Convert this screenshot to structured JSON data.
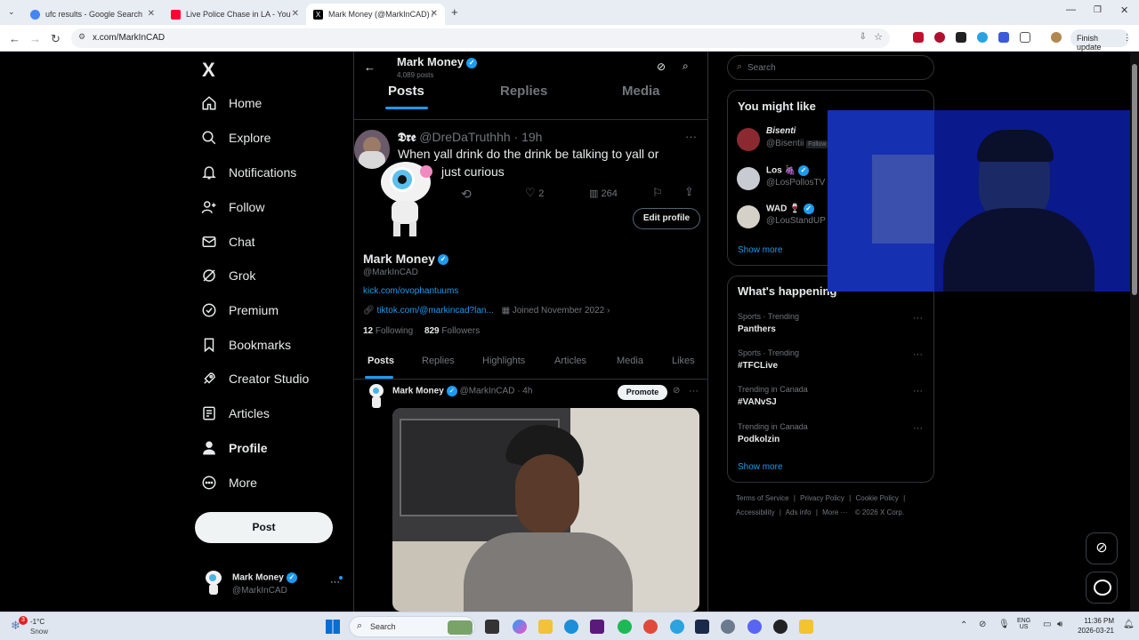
{
  "browser": {
    "tabs": [
      {
        "title": "ufc results - Google Search",
        "active": false
      },
      {
        "title": "Live Police Chase in LA - YouTu",
        "active": false
      },
      {
        "title": "Mark Money (@MarkInCAD) / X",
        "active": true
      }
    ],
    "new_tab": "+",
    "url": "x.com/MarkInCAD",
    "finish_update": "Finish update"
  },
  "sidebar": {
    "logo": "X",
    "items": [
      {
        "label": "Home",
        "icon": "home-icon"
      },
      {
        "label": "Explore",
        "icon": "search-icon"
      },
      {
        "label": "Notifications",
        "icon": "bell-icon"
      },
      {
        "label": "Follow",
        "icon": "person-add-icon"
      },
      {
        "label": "Chat",
        "icon": "mail-icon"
      },
      {
        "label": "Grok",
        "icon": "grok-icon"
      },
      {
        "label": "Premium",
        "icon": "premium-icon"
      },
      {
        "label": "Bookmarks",
        "icon": "bookmark-icon"
      },
      {
        "label": "Creator Studio",
        "icon": "rocket-icon"
      },
      {
        "label": "Articles",
        "icon": "article-icon"
      },
      {
        "label": "Profile",
        "icon": "person-icon"
      },
      {
        "label": "More",
        "icon": "more-circle-icon"
      }
    ],
    "post_label": "Post",
    "account": {
      "name": "Mark Money",
      "handle": "@MarkInCAD",
      "more": "···"
    }
  },
  "header": {
    "name": "Mark Money",
    "posts_count": "4,089 posts",
    "tabs": [
      "Posts",
      "Replies",
      "Media"
    ]
  },
  "floating_tweet": {
    "author": "𝕯𝖗𝖊",
    "handle": "@DreDaTruthhh",
    "time": "· 19h",
    "text_line1": "When yall drink do the drink be talking to yall or",
    "text_line2": "just curious",
    "likes": "2",
    "views": "264",
    "more": "···"
  },
  "profile": {
    "edit_label": "Edit profile",
    "name": "Mark Money",
    "handle": "@MarkInCAD",
    "bio_link": "kick.com/ovophantuums",
    "website": "tiktok.com/@markincad?lan...",
    "joined": "Joined November 2022",
    "following_count": "12",
    "following_label": "Following",
    "followers_count": "829",
    "followers_label": "Followers",
    "tabs": [
      "Posts",
      "Replies",
      "Highlights",
      "Articles",
      "Media",
      "Likes"
    ]
  },
  "post": {
    "author": "Mark Money",
    "handle": "@MarkInCAD",
    "time": "· 4h",
    "promote": "Promote",
    "more": "···"
  },
  "right": {
    "search_placeholder": "Search",
    "you_might_like": "You might like",
    "suggestions": [
      {
        "name": "Bisenti",
        "handle": "@Bisentii",
        "badge": "Follow"
      },
      {
        "name": "Los 🍇",
        "handle": "@LosPollosTV"
      },
      {
        "name": "WAD 🍷",
        "handle": "@LouStandUP"
      }
    ],
    "show_more": "Show more",
    "whats_happening": "What's happening",
    "trends": [
      {
        "meta": "Sports · Trending",
        "name": "Panthers"
      },
      {
        "meta": "Sports · Trending",
        "name": "#TFCLive"
      },
      {
        "meta": "Trending in Canada",
        "name": "#VANvSJ"
      },
      {
        "meta": "Trending in Canada",
        "name": "Podkolzin"
      }
    ],
    "show_more_2": "Show more",
    "footer_row1": [
      "Terms of Service",
      "|",
      "Privacy Policy",
      "|",
      "Cookie Policy",
      "|"
    ],
    "footer_row2": [
      "Accessibility",
      "|",
      "Ads info",
      "|",
      "More ···",
      "© 2026 X Corp."
    ]
  },
  "taskbar": {
    "weather_temp": "-1°C",
    "weather_desc": "Snow",
    "weather_badge": "3",
    "search": "Search",
    "lang1": "ENG",
    "lang2": "US",
    "time": "11:36 PM",
    "date": "2026-03-21"
  },
  "colors": {
    "accent": "#1d9bf0",
    "background": "#000000",
    "text": "#e7e9ea",
    "muted": "#71767b"
  }
}
